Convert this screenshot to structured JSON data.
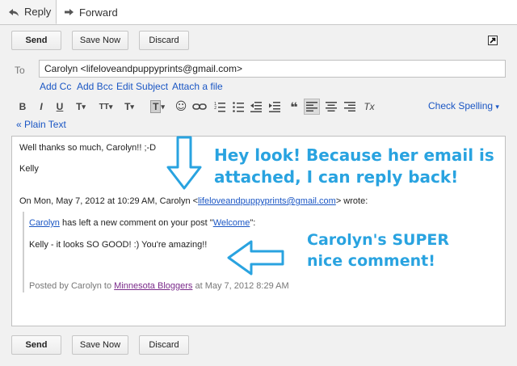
{
  "tabs": {
    "reply": "Reply",
    "forward": "Forward"
  },
  "actions": {
    "send": "Send",
    "save_now": "Save Now",
    "discard": "Discard"
  },
  "recipient": {
    "label": "To",
    "value": "Carolyn <lifeloveandpuppyprints@gmail.com>"
  },
  "recipient_links": {
    "add_cc": "Add Cc",
    "add_bcc": "Add Bcc",
    "edit_subject": "Edit Subject",
    "attach": "Attach a file"
  },
  "toolbar": {
    "bold": "B",
    "italic": "I",
    "underline": "U",
    "font": "T",
    "size": "TT",
    "color": "T",
    "highlight": "T",
    "emoji": "☺",
    "link": "⊖",
    "numbered": "1≡",
    "bulleted": "•≡",
    "outdent": "⇤",
    "indent": "⇥",
    "quote": "❝",
    "align_left": "≡",
    "align_center": "≡",
    "align_right": "≡",
    "remove_format": "Tx",
    "spell_check": "Check Spelling",
    "spell_caret": "▾"
  },
  "plain_text_link": "« Plain Text",
  "body": {
    "line1": "Well thanks so much, Carolyn!! ;-D",
    "line2": "Kelly",
    "quote_header_pre": "On Mon, May 7, 2012 at 10:29 AM, Carolyn <",
    "quote_header_email": "lifeloveandpuppyprints@gmail.com",
    "quote_header_post": "> wrote:",
    "comment_author": "Carolyn",
    "comment_mid": " has left a new comment on your post \"",
    "comment_post": "Welcome",
    "comment_end": "\":",
    "comment_text": "Kelly - it looks SO GOOD! :) You're amazing!!",
    "posted_pre": "Posted by Carolyn to ",
    "posted_blog": "Minnesota Bloggers",
    "posted_post": " at May 7, 2012 8:29 AM"
  },
  "annotations": {
    "top_line1": "Hey look! Because her email is",
    "top_line2": "attached, I can reply back!",
    "mid_line1": "Carolyn's SUPER",
    "mid_line2": "nice comment!"
  },
  "colors": {
    "link": "#1a56c4",
    "annotation": "#29a3e0",
    "panel": "#f1f1f1"
  }
}
